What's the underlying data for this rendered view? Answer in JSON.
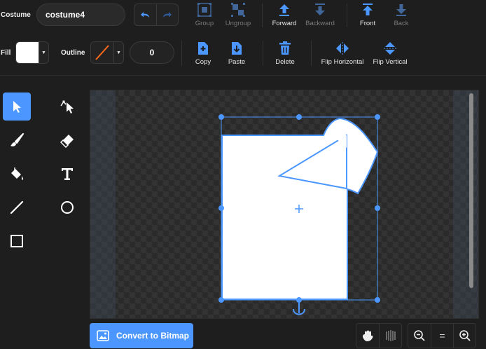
{
  "costume": {
    "label": "Costume",
    "name": "costume4"
  },
  "toolbar": {
    "group": "Group",
    "ungroup": "Ungroup",
    "forward": "Forward",
    "backward": "Backward",
    "front": "Front",
    "back": "Back"
  },
  "style": {
    "fill_label": "Fill",
    "fill_color": "#ffffff",
    "outline_label": "Outline",
    "outline_color": "#ff6a1a",
    "outline_width": "0"
  },
  "actions": {
    "copy": "Copy",
    "paste": "Paste",
    "delete": "Delete",
    "flip_horizontal": "Flip Horizontal",
    "flip_vertical": "Flip Vertical"
  },
  "tools": [
    "select-tool",
    "reshape-tool",
    "brush-tool",
    "eraser-tool",
    "fill-tool",
    "text-tool",
    "line-tool",
    "circle-tool",
    "rectangle-tool"
  ],
  "bottom": {
    "convert": "Convert to Bitmap",
    "zoom_reset": "="
  },
  "colors": {
    "accent": "#4c97ff",
    "delete": "#4c97ff"
  }
}
